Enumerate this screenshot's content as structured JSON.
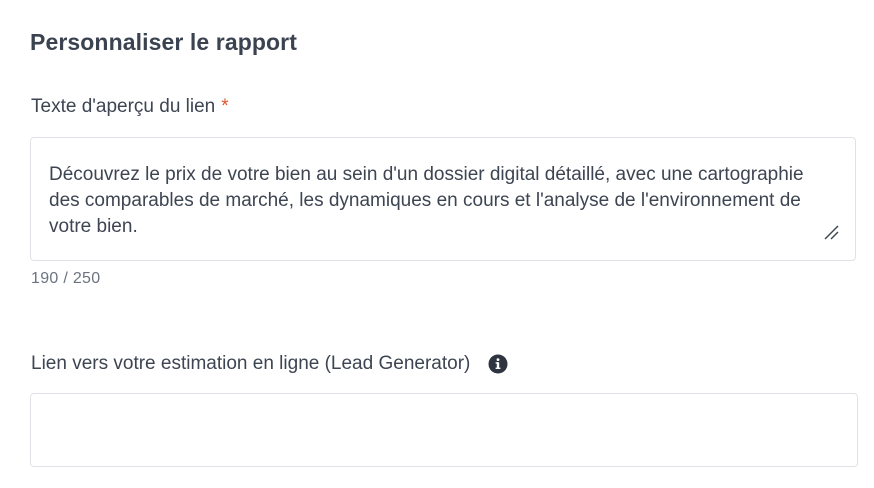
{
  "section": {
    "title": "Personnaliser le rapport"
  },
  "preview_field": {
    "label": "Texte d'aperçu du lien",
    "required_mark": "*",
    "value": "Découvrez le prix de votre bien au sein d'un dossier digital détaillé, avec une cartographie des comparables de marché, les dynamiques en cours et l'analyse de l'environnement de votre bien.",
    "counter": "190 / 250"
  },
  "lead_field": {
    "label": "Lien vers votre estimation en ligne (Lead Generator)",
    "value": "",
    "info_icon": "info-icon"
  },
  "colors": {
    "text": "#3d4552",
    "required": "#e0562b",
    "border": "#dfe2e6",
    "muted": "#6b7380"
  }
}
